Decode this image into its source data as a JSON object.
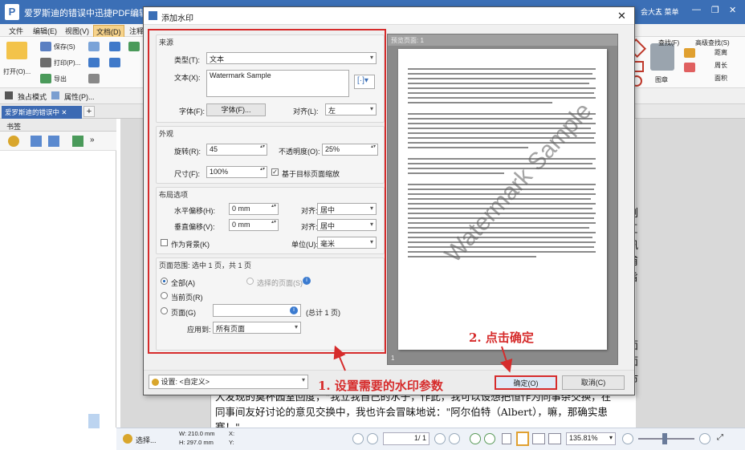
{
  "app": {
    "title": "爱罗斯迪的错误中迅捷PDF编辑器",
    "titlebar_right": [
      "会大人",
      "三 菜单"
    ],
    "window_controls": [
      "—",
      "❐",
      "✕"
    ]
  },
  "menus": [
    "文件",
    "编辑(E)",
    "视图(V)",
    "文档(D)",
    "注释"
  ],
  "ribbon": {
    "left_items": [
      "打开(O)...",
      "保存(S)",
      "打印(P)...",
      "导出"
    ],
    "right_items": [
      "查找(F)",
      "高级查找(S)",
      "距离",
      "周长",
      "面积",
      "图章"
    ]
  },
  "subbar": [
    "独占模式",
    "属性(P)..."
  ],
  "doc_tab": "爱罗斯迪的错误中",
  "sidebar": {
    "title": "书签"
  },
  "document": {
    "right_edge_chars": [
      "剐",
      "匚",
      "讯",
      "甫",
      "旨",
      "面",
      "面",
      "市"
    ],
    "bottom_lines": [
      "大发现的莫杯园室回度，\"我立我自己的水子，作此，我可以设想把恒作为同事杂交换，在",
      "同事间友好讨论的意见交换中，我也许会冒昧地说：\"阿尔伯特（Albert），嘛，那确实患",
      "赛！\""
    ]
  },
  "statusbar": {
    "select_label": "选择...",
    "width": "W: 210.0 mm",
    "height": "H: 297.0 mm",
    "x_label": "X:",
    "y_label": "Y:",
    "page_value": "1",
    "page_total": "/ 1",
    "zoom": "135.81%"
  },
  "dialog": {
    "title": "添加水印",
    "source": {
      "section_title": "来源",
      "type_label": "类型(T):",
      "type_value": "文本",
      "text_label": "文本(X):",
      "text_value": "Watermark Sample",
      "font_label": "字体(F):",
      "font_button": "字体(F)...",
      "align_label": "对齐(L):",
      "align_value": "左"
    },
    "appearance": {
      "section_title": "外观",
      "rotation_label": "旋转(R):",
      "rotation_value": "45",
      "opacity_label": "不透明度(O):",
      "opacity_value": "25%",
      "size_label": "尺寸(F):",
      "size_value": "100%",
      "relative_scale_label": "基于目标页面缩放"
    },
    "layout": {
      "section_title": "布局选项",
      "h_offset_label": "水平偏移(H):",
      "h_offset_value": "0 mm",
      "h_align_label": "对齐:",
      "h_align_value": "居中",
      "v_offset_label": "垂直偏移(V):",
      "v_offset_value": "0 mm",
      "v_align_label": "对齐:",
      "v_align_value": "居中",
      "background_label": "作为背景(K)",
      "unit_label": "单位(U):",
      "unit_value": "毫米"
    },
    "page_range": {
      "section_title": "页面范围: 选中 1 页，共 1 页",
      "all_label": "全部(A)",
      "selected_label": "选择的页面(S)",
      "current_label": "当前页(R)",
      "pages_label": "页面(G)",
      "pages_total": "(总计 1 页)",
      "apply_label": "应用到:",
      "apply_value": "所有页面"
    },
    "preview": {
      "header": "预览页面: 1",
      "watermark": "Watermark Sample",
      "page_number": "1"
    },
    "settings_label": "设置:",
    "settings_value": "<自定义>",
    "ok": "确定(O)",
    "cancel": "取消(C)"
  },
  "annotations": {
    "step1": "1. 设置需要的水印参数",
    "step2": "2. 点击确定"
  },
  "colors": {
    "annotation_red": "#d62b2b",
    "titlebar_blue": "#3b6fb6"
  }
}
